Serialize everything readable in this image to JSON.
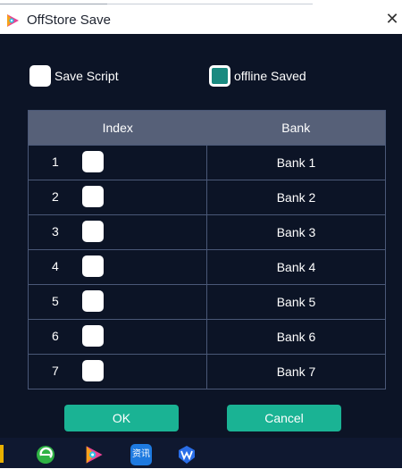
{
  "window": {
    "title": "OffStore Save",
    "close_glyph": "✕"
  },
  "options": {
    "save_script": {
      "label": "Save Script",
      "checked": false
    },
    "offline_saved": {
      "label": "offline Saved",
      "checked": true
    }
  },
  "table": {
    "headers": [
      "Index",
      "Bank"
    ],
    "rows": [
      {
        "index": "1",
        "bank": "Bank 1",
        "checked": false
      },
      {
        "index": "2",
        "bank": "Bank 2",
        "checked": false
      },
      {
        "index": "3",
        "bank": "Bank 3",
        "checked": false
      },
      {
        "index": "4",
        "bank": "Bank 4",
        "checked": false
      },
      {
        "index": "5",
        "bank": "Bank 5",
        "checked": false
      },
      {
        "index": "6",
        "bank": "Bank 6",
        "checked": false
      },
      {
        "index": "7",
        "bank": "Bank 7",
        "checked": false
      }
    ]
  },
  "buttons": {
    "ok": "OK",
    "cancel": "Cancel"
  },
  "taskbar": {
    "icons": [
      "browser-icon",
      "video-player-icon",
      "news-app-icon",
      "shield-app-icon"
    ],
    "news_app_text": "资讯"
  },
  "colors": {
    "background": "#0c1426",
    "accent": "#1ab394",
    "header": "#566078",
    "grid_line": "#4a5877"
  }
}
